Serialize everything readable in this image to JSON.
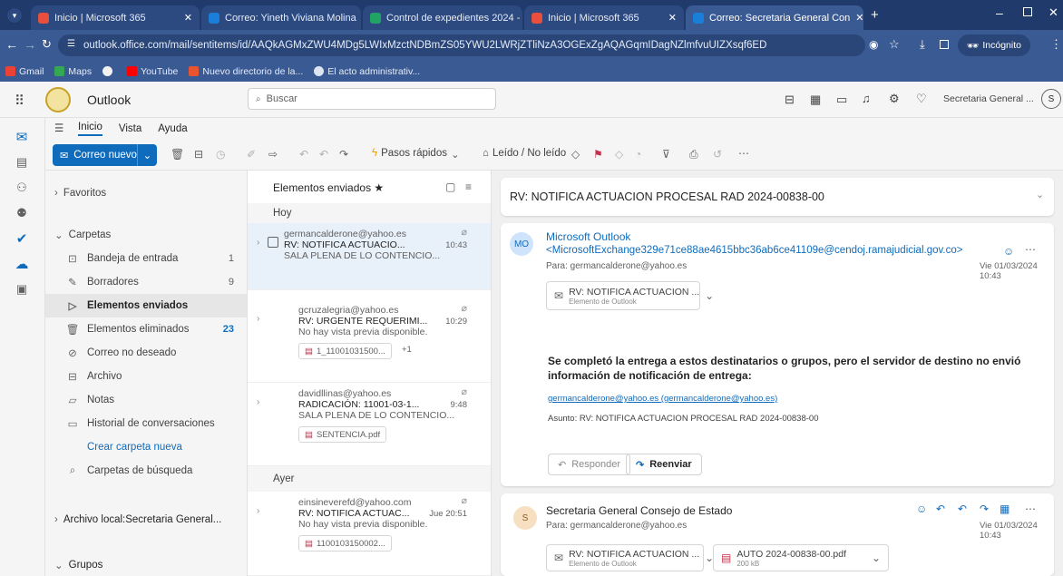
{
  "browser": {
    "tabs": [
      {
        "label": "Inicio | Microsoft 365",
        "active": false
      },
      {
        "label": "Correo: Yineth Viviana Molina",
        "active": false
      },
      {
        "label": "Control de expedientes 2024 -",
        "active": false
      },
      {
        "label": "Inicio | Microsoft 365",
        "active": false
      },
      {
        "label": "Correo: Secretaria General Con",
        "active": true
      }
    ],
    "url": "outlook.office.com/mail/sentitems/id/AAQkAGMxZWU4MDg5LWIxMzctNDBmZS05YWU2LWRjZTliNzA3OGExZgAQAGqmIDagNZlmfvuUIZXsqf6ED",
    "incognito_label": "Incógnito",
    "bookmarks": [
      "Gmail",
      "Maps",
      "",
      "YouTube",
      "Nuevo directorio de la...",
      "El acto administrativ..."
    ]
  },
  "app": {
    "name": "Outlook",
    "search_placeholder": "Buscar",
    "account": "Secretaria General ...",
    "account_initial": "S"
  },
  "ribbon": {
    "tabs": [
      "Inicio",
      "Vista",
      "Ayuda"
    ],
    "new_mail": "Correo nuevo",
    "quick_steps": "Pasos rápidos",
    "read_unread": "Leído / No leído"
  },
  "folders": {
    "favorites": "Favoritos",
    "folders_header": "Carpetas",
    "items": [
      {
        "label": "Bandeja de entrada",
        "count": "1"
      },
      {
        "label": "Borradores",
        "count": "9"
      },
      {
        "label": "Elementos enviados",
        "count": ""
      },
      {
        "label": "Elementos eliminados",
        "count": "23"
      },
      {
        "label": "Correo no deseado",
        "count": ""
      },
      {
        "label": "Archivo",
        "count": ""
      },
      {
        "label": "Notas",
        "count": ""
      },
      {
        "label": "Historial de conversaciones",
        "count": ""
      }
    ],
    "create_folder": "Crear carpeta nueva",
    "search_folders": "Carpetas de búsqueda",
    "local_archive": "Archivo local:Secretaria General...",
    "groups": "Grupos"
  },
  "message_list": {
    "title": "Elementos enviados",
    "groups": [
      "Hoy",
      "Ayer"
    ],
    "messages": [
      {
        "from": "germancalderone@yahoo.es",
        "subject": "RV: NOTIFICA ACTUACIO...",
        "time": "10:43",
        "preview": "SALA PLENA DE LO CONTENCIO...",
        "attachment": ""
      },
      {
        "from": "gcruzalegria@yahoo.es",
        "subject": "RV: URGENTE REQUERIMI...",
        "time": "10:29",
        "preview": "No hay vista previa disponible.",
        "attachment": "1_11001031500...",
        "extra": "+1"
      },
      {
        "from": "davidllinas@yahoo.es",
        "subject": "RADICACIÓN: 11001-03-1...",
        "time": "9:48",
        "preview": "SALA PLENA DE LO CONTENCIO...",
        "attachment": "SENTENCIA.pdf"
      },
      {
        "from": "einsineverefd@yahoo.com",
        "subject": "RV: NOTIFICA ACTUAC...",
        "time": "Jue 20:51",
        "preview": "No hay vista previa disponible.",
        "attachment": "1100103150002..."
      }
    ]
  },
  "reading": {
    "subject": "RV: NOTIFICA ACTUACION PROCESAL RAD 2024-00838-00",
    "msg1": {
      "initials": "MO",
      "sender": "Microsoft Outlook",
      "address": "<MicrosoftExchange329e71ce88ae4615bbc36ab6ce41109e@cendoj.ramajudicial.gov.co>",
      "to": "Para:  germancalderone@yahoo.es",
      "date": "Vie 01/03/2024 10:43",
      "chip_title": "RV: NOTIFICA ACTUACION ...",
      "chip_sub": "Elemento de Outlook",
      "body_bold": "Se completó la entrega a estos destinatarios o grupos, pero el servidor de destino no envió información de notificación de entrega:",
      "link": "germancalderone@yahoo.es (germancalderone@yahoo.es)",
      "asunto": "Asunto: RV: NOTIFICA ACTUACION PROCESAL RAD 2024-00838-00",
      "reply": "Responder",
      "forward": "Reenviar"
    },
    "msg2": {
      "initials": "S",
      "sender": "Secretaria General Consejo de Estado",
      "to": "Para:  germancalderone@yahoo.es",
      "date": "Vie 01/03/2024 10:43",
      "chip1_title": "RV: NOTIFICA ACTUACION ...",
      "chip1_sub": "Elemento de Outlook",
      "chip2_title": "AUTO 2024-00838-00.pdf",
      "chip2_sub": "200 kB"
    }
  },
  "colors": {
    "accent": "#0f6cbd",
    "browser": "#3a5a94"
  }
}
